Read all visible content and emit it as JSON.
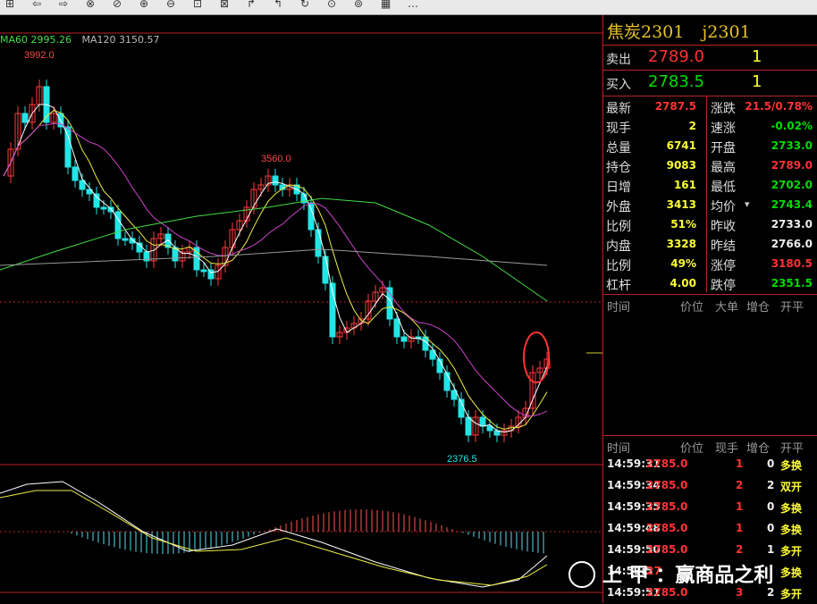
{
  "toolbar": {
    "items": [
      "⊞",
      "⇦",
      "⇨",
      "⊗",
      "⊘",
      "⊕",
      "⊖",
      "⊡",
      "⊠",
      "↱",
      "↰",
      "↻",
      "⊙",
      "⊚",
      "▦",
      "…"
    ]
  },
  "legend": {
    "ma60": "MA60 2995.26",
    "ma120": "MA120 3150.57",
    "ma60_color": "#44dd44",
    "ma120_color": "#bbbbbb"
  },
  "chart_labels": {
    "high": "3992.0",
    "mid_high": "3560.0",
    "low": "2376.5"
  },
  "quote": {
    "title_name": "焦炭2301",
    "title_code": "j2301",
    "ask_label": "卖出",
    "ask_price": "2789.0",
    "ask_qty": "1",
    "bid_label": "买入",
    "bid_price": "2783.5",
    "bid_qty": "1",
    "rows": [
      {
        "l1": "最新",
        "v1": "2787.5",
        "c1": "red",
        "l2": "涨跌",
        "v2": "21.5/0.78%",
        "c2": "red"
      },
      {
        "l1": "现手",
        "v1": "2",
        "c1": "yellow",
        "l2": "速涨",
        "v2": "-0.02%",
        "c2": "green"
      },
      {
        "l1": "总量",
        "v1": "6741",
        "c1": "yellow",
        "l2": "开盘",
        "v2": "2733.0",
        "c2": "green"
      },
      {
        "l1": "持仓",
        "v1": "9083",
        "c1": "yellow",
        "l2": "最高",
        "v2": "2789.0",
        "c2": "red"
      },
      {
        "l1": "日增",
        "v1": "161",
        "c1": "yellow",
        "l2": "最低",
        "v2": "2702.0",
        "c2": "green"
      },
      {
        "l1": "外盘",
        "v1": "3413",
        "c1": "yellow",
        "l2": "均价",
        "v2": "2743.4",
        "c2": "green"
      },
      {
        "l1": "比例",
        "v1": "51%",
        "c1": "yellow",
        "l2": "昨收",
        "v2": "2733.0",
        "c2": "white"
      },
      {
        "l1": "内盘",
        "v1": "3328",
        "c1": "yellow",
        "l2": "昨结",
        "v2": "2766.0",
        "c2": "white"
      },
      {
        "l1": "比例",
        "v1": "49%",
        "c1": "yellow",
        "l2": "涨停",
        "v2": "3180.5",
        "c2": "red"
      },
      {
        "l1": "杠杆",
        "v1": "4.00",
        "c1": "yellow",
        "l2": "跌停",
        "v2": "2351.5",
        "c2": "green"
      }
    ],
    "avg_dropdown_symbol": "▾"
  },
  "tick_header_1": [
    "时间",
    "价位",
    "大单",
    "增仓",
    "开平"
  ],
  "tick_header_2": [
    "时间",
    "价位",
    "现手",
    "增仓",
    "开平"
  ],
  "ticks": [
    {
      "time": "14:59:31",
      "price": "2785.0",
      "qty": "1",
      "chg": "0",
      "type": "多换"
    },
    {
      "time": "14:59:34",
      "price": "2785.0",
      "qty": "2",
      "chg": "2",
      "type": "双开"
    },
    {
      "time": "14:59:35",
      "price": "2785.0",
      "qty": "1",
      "chg": "0",
      "type": "多换"
    },
    {
      "time": "14:59:48",
      "price": "2785.0",
      "qty": "1",
      "chg": "0",
      "type": "多换"
    },
    {
      "time": "14:59:50",
      "price": "2785.0",
      "qty": "2",
      "chg": "1",
      "type": "多开"
    },
    {
      "time": "14:59:5",
      "price": "27",
      "qty": "",
      "chg": "",
      "type": "多换"
    },
    {
      "time": "14:59:51",
      "price": "2785.0",
      "qty": "3",
      "chg": "2",
      "type": "多开"
    }
  ],
  "watermark": "上 甲 ：赢商品之利"
}
